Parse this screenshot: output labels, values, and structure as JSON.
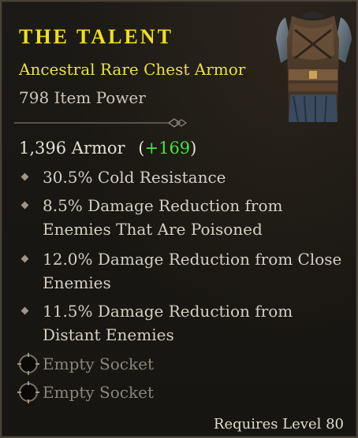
{
  "item": {
    "name": "THE TALENT",
    "type_line": "Ancestral Rare Chest Armor",
    "item_power": "798 Item Power",
    "armor_value": "1,396 Armor",
    "armor_bonus": "+169",
    "armor_paren_open": "(",
    "armor_paren_close": ")",
    "affixes": [
      "30.5% Cold Resistance",
      "8.5% Damage Reduction from Enemies That Are Poisoned",
      "12.0% Damage Reduction from Close Enemies",
      "11.5% Damage Reduction from Distant Enemies"
    ],
    "sockets": [
      "Empty Socket",
      "Empty Socket"
    ],
    "requirement": "Requires Level 80",
    "art_icon": "chest-armor-icon"
  },
  "colors": {
    "title": "#f2df1f",
    "rarity": "#e8e14a",
    "bonus": "#3fe63f",
    "socket_text": "#8b857b"
  }
}
